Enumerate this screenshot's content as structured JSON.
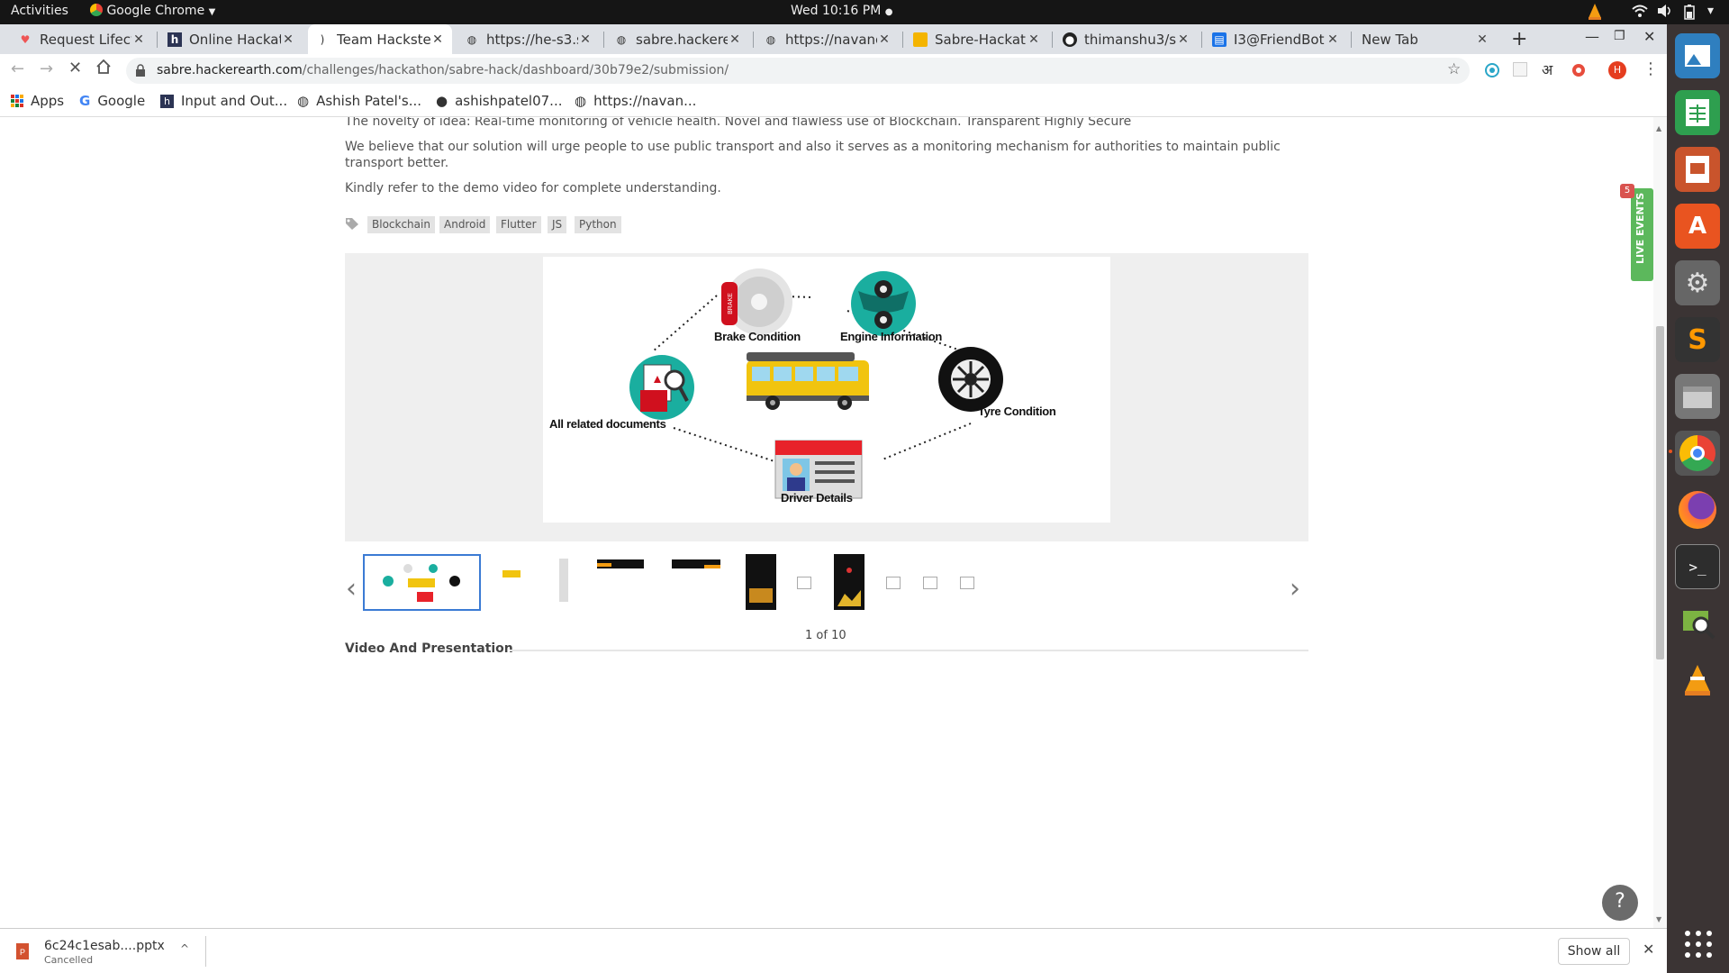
{
  "topbar": {
    "activities": "Activities",
    "app": "Google Chrome",
    "clock": "Wed 10:16 PM"
  },
  "tabs": [
    {
      "title": "Request Lifecy"
    },
    {
      "title": "Online Hackat"
    },
    {
      "title": "Team Hackster"
    },
    {
      "title": "https://he-s3.s"
    },
    {
      "title": "sabre.hackerea"
    },
    {
      "title": "https://navanc"
    },
    {
      "title": "Sabre-Hackath"
    },
    {
      "title": "thimanshu3/sa"
    },
    {
      "title": "I3@FriendBot"
    },
    {
      "title": "New Tab"
    }
  ],
  "address": {
    "host": "sabre.hackerearth.com",
    "path": "/challenges/hackathon/sabre-hack/dashboard/30b79e2/submission/"
  },
  "profile_initial": "H",
  "hindi_icon": "अ",
  "bookmarks": [
    "Apps",
    "Google",
    "Input and Out...",
    "Ashish Patel's...",
    "ashishpatel07...",
    "https://navan..."
  ],
  "content": {
    "p1": "The novelty of idea: Real-time monitoring of vehicle health. Novel and flawless use of Blockchain. Transparent Highly Secure",
    "p2": "We believe that our solution will urge people to use public transport and also it serves as a monitoring mechanism for authorities to maintain public transport better.",
    "p3": "Kindly refer to the demo video for complete understanding.",
    "tags": [
      "Blockchain",
      "Android",
      "Flutter",
      "JS",
      "Python"
    ]
  },
  "slide": {
    "brake_label": "Brake Condition",
    "brake_text": "BRAKE",
    "engine_label": "Engine Information",
    "docs_label": "All related documents",
    "tyre_label": "Tyre Condition",
    "driver_label": "Driver Details"
  },
  "carousel": {
    "counter": "1 of 10"
  },
  "section_title": "Video And Presentation",
  "live_events": {
    "label": "LIVE EVENTS",
    "count": "5"
  },
  "downloads": {
    "filename": "6c24c1esab....pptx",
    "status": "Cancelled",
    "show_all": "Show all"
  },
  "colors": {
    "teal": "#1aae9f",
    "brake_red": "#d0101e",
    "bus_yellow": "#f1c40f",
    "live_green": "#5cb85c"
  }
}
